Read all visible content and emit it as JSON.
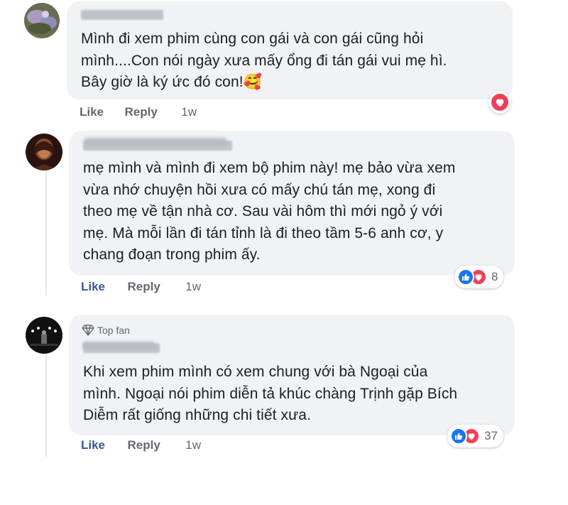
{
  "comments": [
    {
      "text_lines": [
        "Mình đi xem phim cùng con gái và con gái cũng hỏi",
        "mình....Con nói ngày xưa mấy ổng đi tán gái vui mẹ hì.",
        "Bây giờ là ký ức đó con!"
      ],
      "emoji": "🥰",
      "like_label": "Like",
      "reply_label": "Reply",
      "time": "1w",
      "reaction_icons": [
        "love-icon"
      ]
    },
    {
      "text_lines": [
        "mẹ mình và mình đi xem bộ phim này! mẹ bảo vừa xem",
        "vừa nhớ chuyện hồi xưa có mấy chú tán mẹ, xong đi",
        "theo mẹ về tận nhà cơ. Sau vài hôm thì mới ngỏ ý với",
        "mẹ. Mà mỗi lần đi tán tỉnh là đi theo tầm 5-6 anh cơ, y",
        "chang đoạn trong phim ấy."
      ],
      "like_label": "Like",
      "reply_label": "Reply",
      "time": "1w",
      "reaction_count": "8",
      "reaction_icons": [
        "like-icon",
        "love-icon"
      ]
    },
    {
      "badge": "Top fan",
      "badge_icon": "diamond-icon",
      "text_lines": [
        "Khi xem phim mình có xem chung với bà Ngoại của",
        "mình. Ngoại nói phim diễn tả khúc chàng Trịnh gặp Bích",
        "Diễm rất giống những chi tiết xưa."
      ],
      "like_label": "Like",
      "reply_label": "Reply",
      "time": "1w",
      "reaction_count": "37",
      "reaction_icons": [
        "like-icon",
        "love-icon"
      ]
    }
  ],
  "colors": {
    "bubble": "#f0f2f5",
    "like_blue": "#1877f2",
    "love_red": "#f33e58",
    "meta_grey": "#65676b"
  }
}
